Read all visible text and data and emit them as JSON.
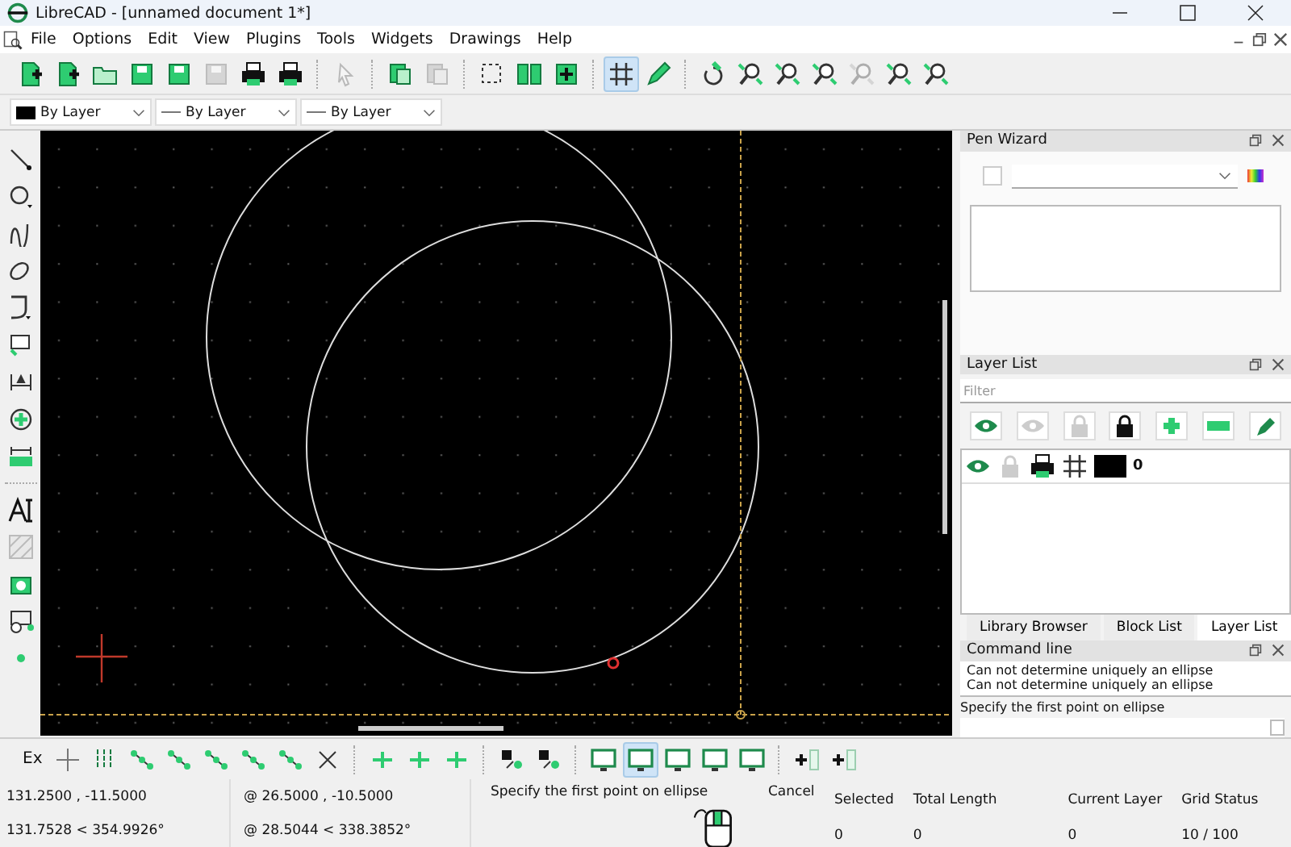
{
  "window": {
    "title": "LibreCAD - [unnamed document 1*]"
  },
  "menu": [
    "File",
    "Options",
    "Edit",
    "View",
    "Plugins",
    "Tools",
    "Widgets",
    "Drawings",
    "Help"
  ],
  "main_toolbar": [
    {
      "kind": "doc-plus"
    },
    {
      "kind": "doc-plus"
    },
    {
      "kind": "folder"
    },
    {
      "kind": "disk"
    },
    {
      "kind": "disk"
    },
    {
      "kind": "disk",
      "disabled": true
    },
    {
      "kind": "printer"
    },
    {
      "kind": "printer"
    },
    {
      "kind": "sep"
    },
    {
      "kind": "pointer",
      "disabled": true
    },
    {
      "kind": "sep"
    },
    {
      "kind": "copy"
    },
    {
      "kind": "copy",
      "disabled": true
    },
    {
      "kind": "sep"
    },
    {
      "kind": "dashed"
    },
    {
      "kind": "panels"
    },
    {
      "kind": "panel-plus"
    },
    {
      "kind": "sep"
    },
    {
      "kind": "grid",
      "selected": true
    },
    {
      "kind": "pencil"
    },
    {
      "kind": "sep"
    },
    {
      "kind": "redraw"
    },
    {
      "kind": "zoom"
    },
    {
      "kind": "zoom"
    },
    {
      "kind": "zoom"
    },
    {
      "kind": "zoom",
      "disabled": true
    },
    {
      "kind": "zoom"
    },
    {
      "kind": "zoom"
    }
  ],
  "pen_toolbar": [
    {
      "value": "By Layer",
      "kind": "color"
    },
    {
      "value": "By Layer",
      "kind": "line"
    },
    {
      "value": "By Layer",
      "kind": "line"
    }
  ],
  "tool_column": [
    {
      "kind": "line"
    },
    {
      "kind": "circle"
    },
    {
      "kind": "curve"
    },
    {
      "kind": "ellipse"
    },
    {
      "kind": "polyline"
    },
    {
      "kind": "select"
    },
    {
      "kind": "dimension"
    },
    {
      "kind": "modify"
    },
    {
      "kind": "measure"
    },
    {
      "kind": "sep"
    },
    {
      "kind": "text"
    },
    {
      "kind": "hatch"
    },
    {
      "kind": "image"
    },
    {
      "kind": "block"
    },
    {
      "kind": "point"
    }
  ],
  "pen_wizard": {
    "title": "Pen Wizard"
  },
  "layer_list": {
    "title": "Layer List",
    "filter_placeholder": "Filter",
    "layers": [
      {
        "name": "0",
        "visible": true,
        "locked": false,
        "printable": true
      }
    ]
  },
  "dock_tabs": [
    {
      "label": "Library Browser",
      "selected": false
    },
    {
      "label": "Block List",
      "selected": false
    },
    {
      "label": "Layer List",
      "selected": true
    }
  ],
  "command_line": {
    "title": "Command line",
    "history": [
      "Can not determine uniquely an ellipse",
      "Can not determine uniquely an ellipse"
    ],
    "prompt": "Specify the first point on ellipse"
  },
  "snap_toolbar": {
    "label": "Ex",
    "items": [
      {
        "kind": "cross"
      },
      {
        "kind": "dots"
      },
      {
        "kind": "snap"
      },
      {
        "kind": "snap"
      },
      {
        "kind": "snap"
      },
      {
        "kind": "snap"
      },
      {
        "kind": "snap"
      },
      {
        "kind": "x"
      },
      {
        "kind": "sep"
      },
      {
        "kind": "restrict"
      },
      {
        "kind": "restrict"
      },
      {
        "kind": "restrict"
      },
      {
        "kind": "sep"
      },
      {
        "kind": "relative"
      },
      {
        "kind": "relative"
      },
      {
        "kind": "sep"
      },
      {
        "kind": "monitor"
      },
      {
        "kind": "monitor",
        "selected": true
      },
      {
        "kind": "monitor"
      },
      {
        "kind": "monitor"
      },
      {
        "kind": "monitor"
      },
      {
        "kind": "sep"
      },
      {
        "kind": "list-plus"
      },
      {
        "kind": "list-plus"
      }
    ]
  },
  "status_bar": {
    "absolute": [
      "131.2500 , -11.5000",
      "131.7528 < 354.9926°"
    ],
    "relative": [
      "@ 26.5000 , -10.5000",
      "@ 28.5044 < 338.3852°"
    ],
    "mouse_left": "Specify the first point on ellipse",
    "mouse_right": "Cancel",
    "fields": [
      {
        "label": "Selected",
        "value": "0"
      },
      {
        "label": "Total Length",
        "value": "0"
      },
      {
        "label": "Current Layer",
        "value": "0"
      },
      {
        "label": "Grid Status",
        "value": "10 / 100"
      }
    ]
  }
}
